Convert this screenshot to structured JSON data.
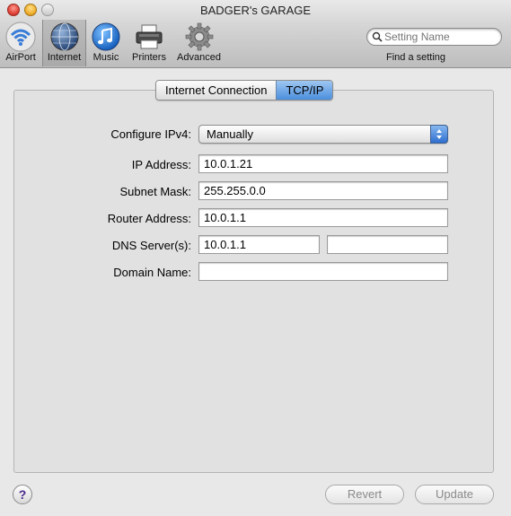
{
  "window": {
    "title": "BADGER's GARAGE"
  },
  "toolbar": {
    "items": [
      {
        "label": "AirPort",
        "icon": "wifi-icon"
      },
      {
        "label": "Internet",
        "icon": "globe-icon",
        "selected": true
      },
      {
        "label": "Music",
        "icon": "music-note-icon"
      },
      {
        "label": "Printers",
        "icon": "printer-icon"
      },
      {
        "label": "Advanced",
        "icon": "gear-icon"
      }
    ],
    "search": {
      "placeholder": "Setting Name",
      "value": ""
    },
    "find_label": "Find a setting"
  },
  "tabs": [
    {
      "label": "Internet Connection",
      "active": false
    },
    {
      "label": "TCP/IP",
      "active": true
    }
  ],
  "form": {
    "configure": {
      "label": "Configure IPv4:",
      "value": "Manually"
    },
    "ip": {
      "label": "IP Address:",
      "value": "10.0.1.21"
    },
    "subnet": {
      "label": "Subnet Mask:",
      "value": "255.255.0.0"
    },
    "router": {
      "label": "Router Address:",
      "value": "10.0.1.1"
    },
    "dns": {
      "label": "DNS Server(s):",
      "value1": "10.0.1.1",
      "value2": ""
    },
    "domain": {
      "label": "Domain Name:",
      "value": ""
    }
  },
  "footer": {
    "help": "?",
    "revert_label": "Revert",
    "update_label": "Update"
  },
  "colors": {
    "accent": "#4b8fdd",
    "disabled_text": "#8a8a8a"
  }
}
